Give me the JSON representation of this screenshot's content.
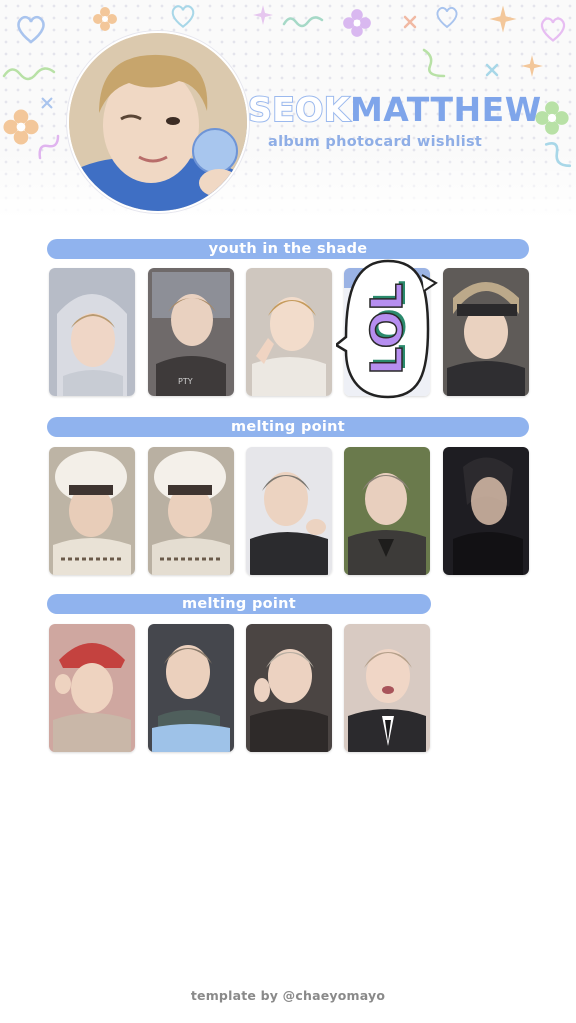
{
  "header": {
    "title_first": "SEOK",
    "title_last": "MATTHEW",
    "subtitle": "album photocard wishlist",
    "avatar_icon": "profile-photo",
    "accent": "#90b3ee"
  },
  "sections": [
    {
      "label": "youth in the shade",
      "cards": [
        {
          "name": "card-hoodie-grey",
          "color": "#b7bcc7"
        },
        {
          "name": "card-dark-window",
          "color": "#6f6a6a"
        },
        {
          "name": "card-white-shirt",
          "color": "#e7e1d7"
        },
        {
          "name": "card-lol-sticker",
          "color": "#eef0f6"
        },
        {
          "name": "card-headband",
          "color": "#5f5b58"
        }
      ]
    },
    {
      "label": "melting point",
      "cards": [
        {
          "name": "card-fur-hat-1",
          "color": "#e9e2d6"
        },
        {
          "name": "card-fur-hat-2",
          "color": "#e4ddd1"
        },
        {
          "name": "card-black-top-wink",
          "color": "#3b3b3e"
        },
        {
          "name": "card-leather-jacket",
          "color": "#3d3b39"
        },
        {
          "name": "card-dark-portrait",
          "color": "#1e1d22"
        }
      ]
    },
    {
      "label": "melting point",
      "cards": [
        {
          "name": "card-red-cap",
          "color": "#cfa7a0"
        },
        {
          "name": "card-scarf",
          "color": "#45474d"
        },
        {
          "name": "card-dark-suit",
          "color": "#4b4543"
        },
        {
          "name": "card-tie",
          "color": "#d8cac2"
        }
      ]
    }
  ],
  "sticker": {
    "text": "LOL",
    "icon": "lol-speech-bubble-sticker"
  },
  "footer": {
    "credit": "template by @chaeyomayo"
  }
}
